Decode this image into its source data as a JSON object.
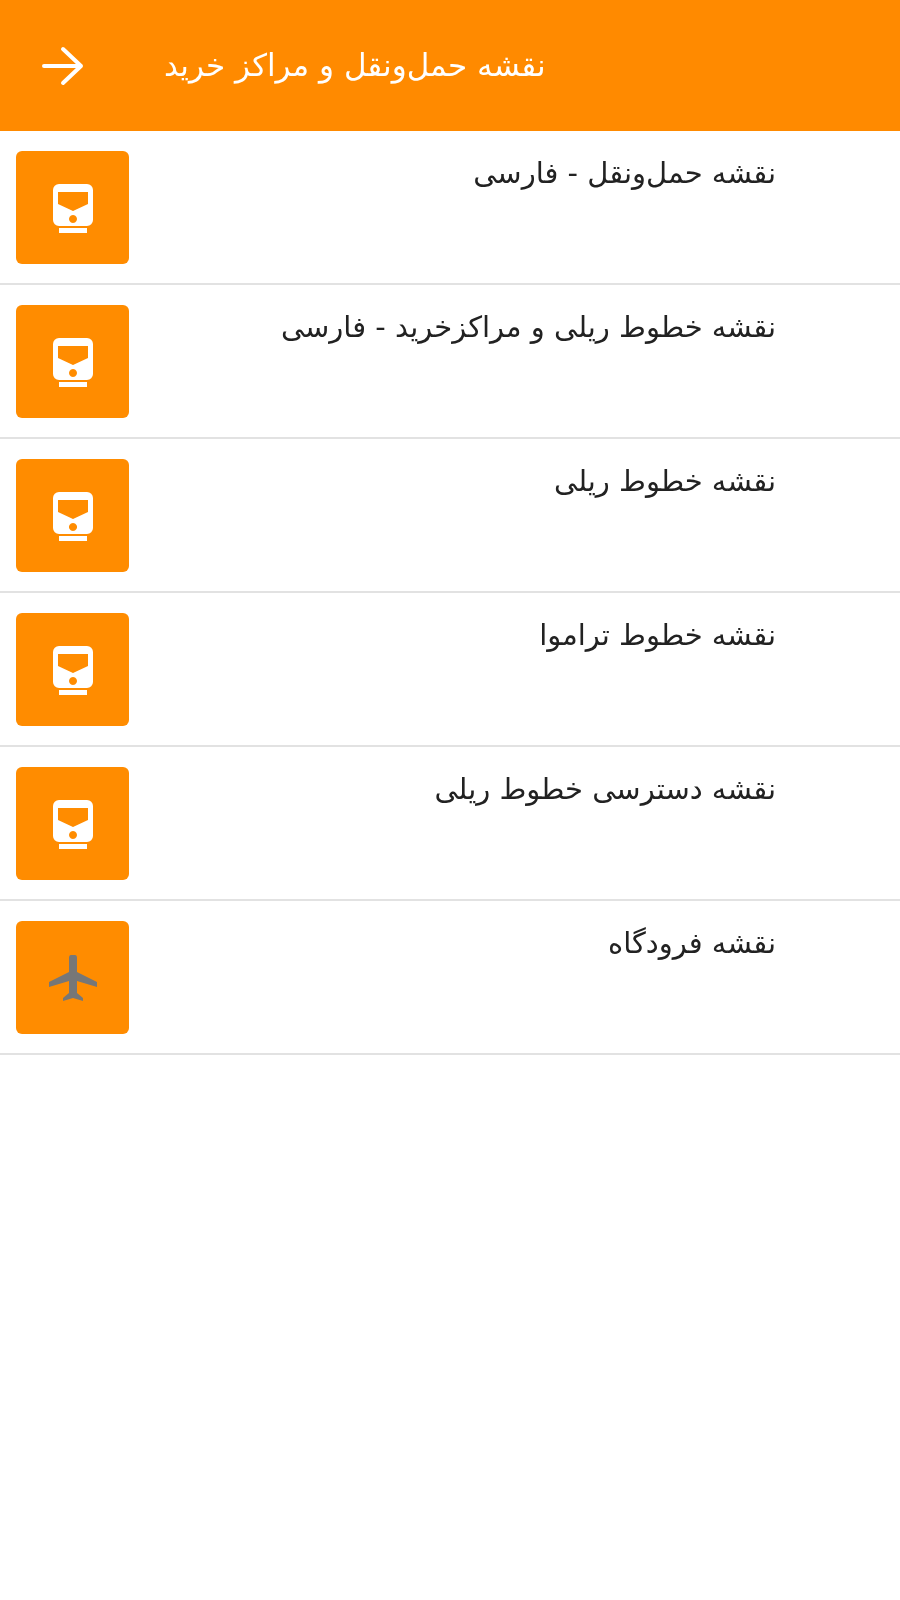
{
  "app_bar": {
    "title": "نقشه حمل‌ونقل و مراکز خرید"
  },
  "items": [
    {
      "label": "نقشه حمل‌ونقل - فارسی",
      "kind": "train"
    },
    {
      "label": "نقشه خطوط ریلی و مراکزخرید - فارسی",
      "kind": "train"
    },
    {
      "label": "نقشه خطوط ریلی",
      "kind": "train"
    },
    {
      "label": "نقشه خطوط تراموا",
      "kind": "train"
    },
    {
      "label": "نقشه دسترسی خطوط ریلی",
      "kind": "train"
    },
    {
      "label": "نقشه فرودگاه",
      "kind": "plane"
    }
  ]
}
